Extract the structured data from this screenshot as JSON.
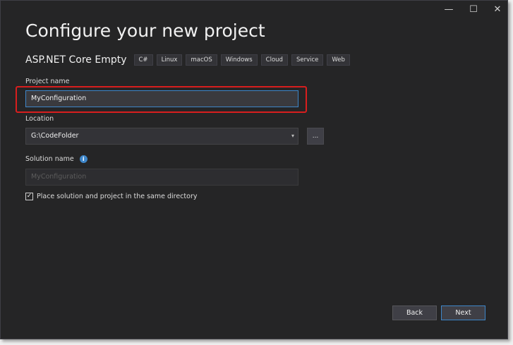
{
  "window": {
    "minimize_glyph": "—",
    "maximize_glyph": "☐",
    "close_glyph": "✕"
  },
  "title": "Configure your new project",
  "template": {
    "name": "ASP.NET Core Empty",
    "tags": [
      "C#",
      "Linux",
      "macOS",
      "Windows",
      "Cloud",
      "Service",
      "Web"
    ]
  },
  "project_name": {
    "label": "Project name",
    "value": "MyConfiguration"
  },
  "location": {
    "label": "Location",
    "value": "G:\\CodeFolder",
    "browse_label": "..."
  },
  "solution_name": {
    "label": "Solution name",
    "placeholder": "MyConfiguration",
    "info_glyph": "i"
  },
  "same_directory": {
    "label": "Place solution and project in the same directory",
    "checked": true,
    "check_glyph": "✓"
  },
  "buttons": {
    "back": "Back",
    "next": "Next"
  },
  "colors": {
    "highlight": "#d81e1e",
    "accent": "#3e86c9",
    "background": "#252526"
  }
}
